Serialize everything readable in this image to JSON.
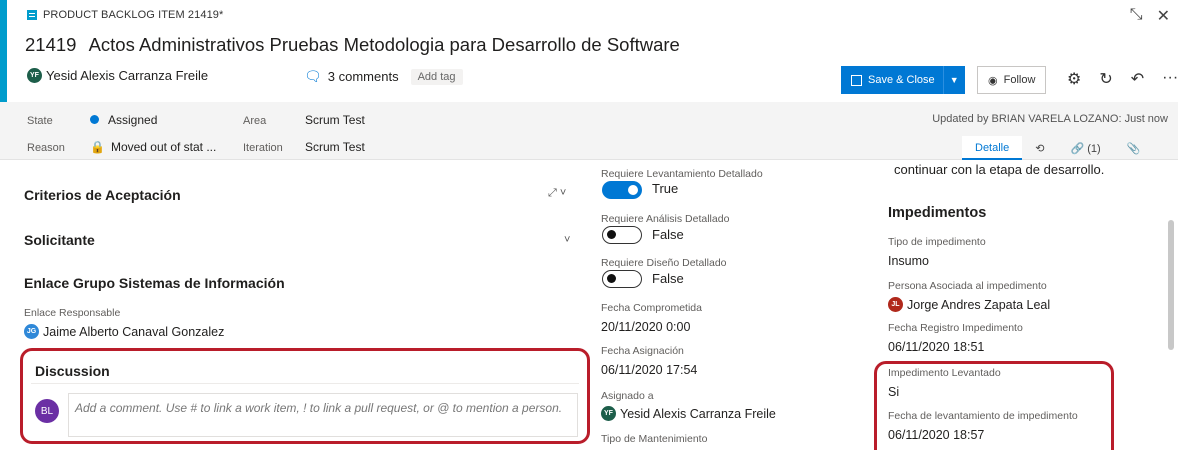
{
  "header": {
    "type_label": "PRODUCT BACKLOG ITEM 21419*",
    "work_item_id": "21419",
    "title": "Actos Administrativos Pruebas Metodologia para Desarrollo de Software",
    "assignee_initials": "YF",
    "assignee": "Yesid Alexis Carranza Freile",
    "comments": "3 comments",
    "add_tag": "Add tag",
    "save_close": "Save & Close",
    "follow": "Follow",
    "minimize_glyph": "⤡",
    "close_glyph": "✕",
    "more_glyph": "···"
  },
  "state_bar": {
    "state_label": "State",
    "state_value": "Assigned",
    "reason_label": "Reason",
    "reason_value": "Moved out of stat ...",
    "area_label": "Area",
    "area_value": "Scrum Test",
    "iteration_label": "Iteration",
    "iteration_value": "Scrum Test",
    "updated": "Updated by BRIAN VARELA LOZANO: Just now",
    "tabs": [
      "Detalle",
      "",
      "(1)",
      ""
    ]
  },
  "left": {
    "criterios": "Criterios de Aceptación",
    "solicitante": "Solicitante",
    "enlace_group": "Enlace Grupo Sistemas de Información",
    "enlace_responsable_label": "Enlace Responsable",
    "enlace_responsable_initials": "JG",
    "enlace_responsable": "Jaime Alberto Canaval Gonzalez",
    "discussion_title": "Discussion",
    "discussion_avatar": "BL",
    "discussion_placeholder": "Add a comment. Use # to link a work item, ! to link a pull request, or @ to mention a person."
  },
  "middle": {
    "levantamiento_label": "Requiere Levantamiento Detallado",
    "levantamiento_value": "True",
    "analisis_label": "Requiere Análisis Detallado",
    "analisis_value": "False",
    "diseno_label": "Requiere Diseño Detallado",
    "diseno_value": "False",
    "fecha_comprometida_label": "Fecha Comprometida",
    "fecha_comprometida": "20/11/2020 0:00",
    "fecha_asignacion_label": "Fecha Asignación",
    "fecha_asignacion": "06/11/2020 17:54",
    "asignado_label": "Asignado a",
    "asignado_initials": "YF",
    "asignado": "Yesid Alexis Carranza Freile",
    "tipo_mantenimiento_label": "Tipo de Mantenimiento"
  },
  "right": {
    "continuar_text": "continuar con la etapa de desarrollo.",
    "impedimentos_title": "Impedimentos",
    "tipo_impedimento_label": "Tipo de impedimento",
    "tipo_impedimento": "Insumo",
    "persona_label": "Persona Asociada al impedimento",
    "persona_initials": "JL",
    "persona": "Jorge Andres Zapata Leal",
    "fecha_registro_label": "Fecha Registro Impedimento",
    "fecha_registro": "06/11/2020 18:51",
    "levantado_label": "Impedimento Levantado",
    "levantado": "Si",
    "fecha_levantamiento_label": "Fecha de levantamiento de impedimento",
    "fecha_levantamiento": "06/11/2020 18:57"
  },
  "colors": {
    "accent": "#009ccc",
    "primary": "#0078d4",
    "highlight": "#b91d2a"
  }
}
